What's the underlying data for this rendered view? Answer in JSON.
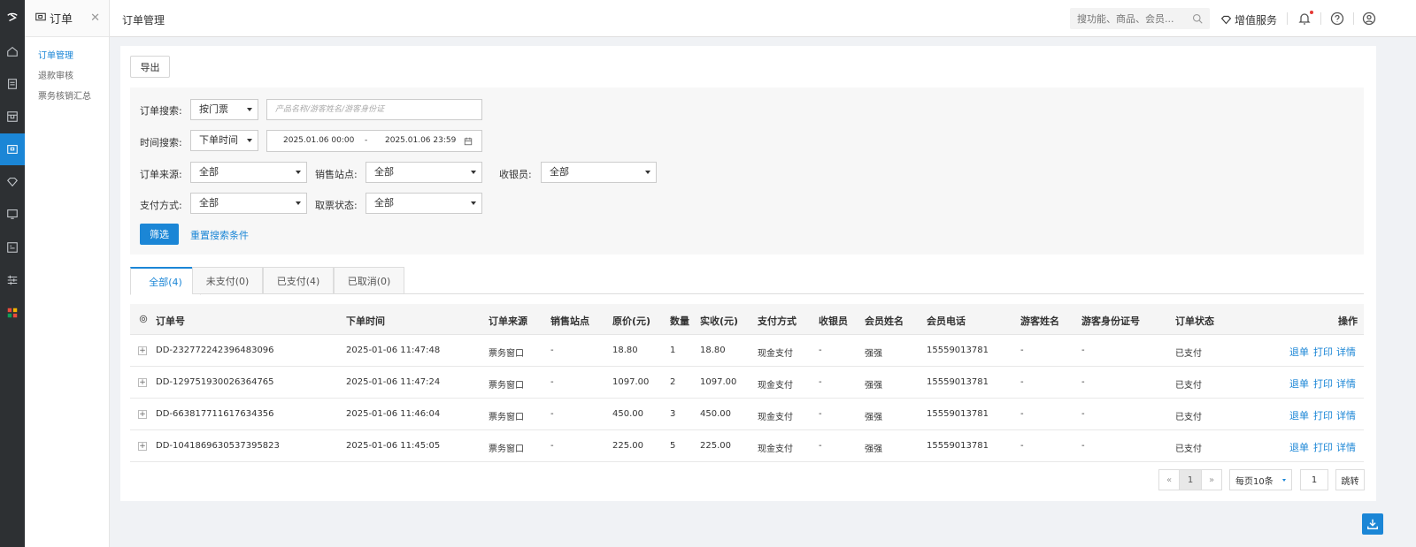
{
  "sidebar_icons": [
    "logo-icon",
    "home-icon",
    "clipboard-icon",
    "box-icon",
    "ticket-icon",
    "diamond-icon",
    "monitor-icon",
    "id-card-icon",
    "sliders-icon",
    "apps-icon"
  ],
  "submenu": {
    "title": "订单",
    "items": [
      {
        "label": "订单管理"
      },
      {
        "label": "退款审核"
      },
      {
        "label": "票务核销汇总"
      }
    ]
  },
  "topbar": {
    "page_title": "订单管理",
    "search_placeholder": "搜功能、商品、会员...",
    "value_added": "增值服务"
  },
  "toolbar": {
    "export_label": "导出"
  },
  "search": {
    "order_search_label": "订单搜索:",
    "order_search_type": "按门票",
    "keyword_placeholder": "产品名称/游客姓名/游客身份证",
    "time_search_label": "时间搜索:",
    "time_type": "下单时间",
    "date_start": "2025.01.06 00:00",
    "date_sep": "-",
    "date_end": "2025.01.06 23:59",
    "source_label": "订单来源:",
    "source_value": "全部",
    "site_label": "销售站点:",
    "site_value": "全部",
    "cashier_label": "收银员:",
    "cashier_value": "全部",
    "pay_label": "支付方式:",
    "pay_value": "全部",
    "pickup_label": "取票状态:",
    "pickup_value": "全部",
    "filter_button": "筛选",
    "reset_link": "重置搜索条件"
  },
  "tabs": [
    {
      "label": "全部(4)"
    },
    {
      "label": "未支付(0)"
    },
    {
      "label": "已支付(4)"
    },
    {
      "label": "已取消(0)"
    }
  ],
  "table": {
    "headers": [
      "订单号",
      "下单时间",
      "订单来源",
      "销售站点",
      "原价(元)",
      "数量",
      "实收(元)",
      "支付方式",
      "收银员",
      "会员姓名",
      "会员电话",
      "游客姓名",
      "游客身份证号",
      "订单状态",
      "操作"
    ],
    "rows": [
      [
        "DD-232772242396483096",
        "2025-01-06 11:47:48",
        "票务窗口",
        "-",
        "18.80",
        "1",
        "18.80",
        "现金支付",
        "-",
        "强强",
        "15559013781",
        "-",
        "-",
        "已支付"
      ],
      [
        "DD-129751930026364765",
        "2025-01-06 11:47:24",
        "票务窗口",
        "-",
        "1097.00",
        "2",
        "1097.00",
        "现金支付",
        "-",
        "强强",
        "15559013781",
        "-",
        "-",
        "已支付"
      ],
      [
        "DD-663817711617634356",
        "2025-01-06 11:46:04",
        "票务窗口",
        "-",
        "450.00",
        "3",
        "450.00",
        "现金支付",
        "-",
        "强强",
        "15559013781",
        "-",
        "-",
        "已支付"
      ],
      [
        "DD-1041869630537395823",
        "2025-01-06 11:45:05",
        "票务窗口",
        "-",
        "225.00",
        "5",
        "225.00",
        "现金支付",
        "-",
        "强强",
        "15559013781",
        "-",
        "-",
        "已支付"
      ]
    ],
    "actions": {
      "refund": "退单",
      "print": "打印",
      "detail": "详情"
    },
    "expand_symbol": "+"
  },
  "pager": {
    "prev": "«",
    "current": "1",
    "next": "»",
    "page_size": "每页10条",
    "jump_value": "1",
    "jump_label": "跳转"
  },
  "colors": {
    "accent": "#1b86d6",
    "sidebar_bg": "#2d3033",
    "badge": "#e53935"
  }
}
